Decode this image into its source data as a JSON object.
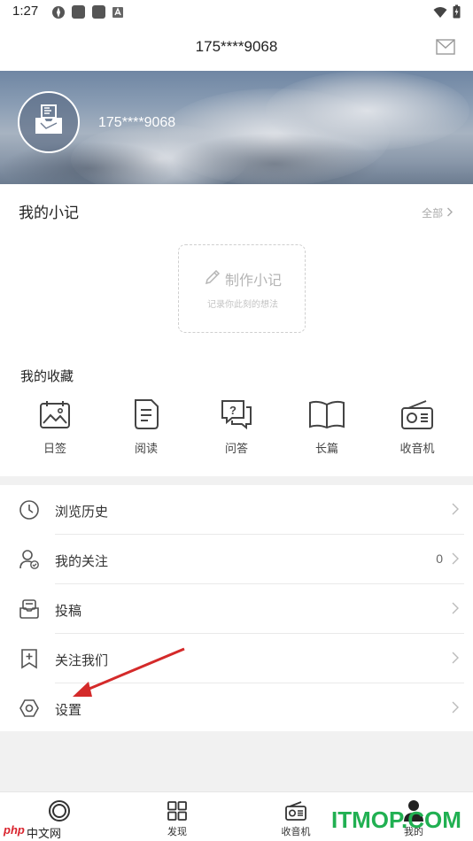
{
  "status": {
    "time": "1:27"
  },
  "header": {
    "title": "175****9068"
  },
  "profile": {
    "name": "175****9068"
  },
  "notes": {
    "title": "我的小记",
    "all_label": "全部",
    "make_label": "制作小记",
    "make_sub": "记录你此刻的想法"
  },
  "favorites": {
    "title": "我的收藏",
    "items": [
      {
        "label": "日签",
        "icon": "calendar-photo-icon"
      },
      {
        "label": "阅读",
        "icon": "document-icon"
      },
      {
        "label": "问答",
        "icon": "question-chat-icon"
      },
      {
        "label": "长篇",
        "icon": "open-book-icon"
      },
      {
        "label": "收音机",
        "icon": "radio-icon"
      }
    ]
  },
  "menu": [
    {
      "label": "浏览历史",
      "icon": "clock-icon",
      "count": ""
    },
    {
      "label": "我的关注",
      "icon": "user-check-icon",
      "count": "0"
    },
    {
      "label": "投稿",
      "icon": "inbox-icon",
      "count": ""
    },
    {
      "label": "关注我们",
      "icon": "bookmark-plus-icon",
      "count": ""
    },
    {
      "label": "设置",
      "icon": "hexagon-settings-icon",
      "count": ""
    }
  ],
  "tabs": [
    {
      "label": "",
      "icon": "home-circle-icon"
    },
    {
      "label": "发现",
      "icon": "grid-icon"
    },
    {
      "label": "收音机",
      "icon": "radio-icon"
    },
    {
      "label": "我的",
      "icon": "user-icon"
    }
  ],
  "watermarks": {
    "left_logo": "php",
    "left_text": "中文网",
    "right": "ITMOP.COM"
  },
  "colors": {
    "arrow": "#d42a2a",
    "watermark_green": "#21b052"
  }
}
